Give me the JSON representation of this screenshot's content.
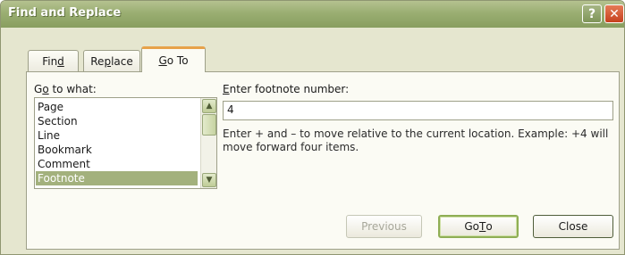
{
  "window": {
    "title": "Find and Replace",
    "help_label": "?",
    "close_label": "✕"
  },
  "tabs": [
    {
      "pre": "Fin",
      "key": "d",
      "post": ""
    },
    {
      "pre": "Re",
      "key": "p",
      "post": "lace"
    },
    {
      "pre": "",
      "key": "G",
      "post": "o To"
    }
  ],
  "goto": {
    "what_label": {
      "pre": "G",
      "key": "o",
      "post": " to what:"
    },
    "items": [
      "Page",
      "Section",
      "Line",
      "Bookmark",
      "Comment",
      "Footnote"
    ],
    "selected": "Footnote",
    "enter_label": {
      "pre": "",
      "key": "E",
      "post": "nter footnote number:"
    },
    "input_value": "4",
    "hint": "Enter + and – to move relative to the current location. Example: +4 will move forward four items."
  },
  "buttons": {
    "previous": "Previous",
    "goto": {
      "pre": "Go ",
      "key": "T",
      "post": "o"
    },
    "close": "Close"
  },
  "colors": {
    "accent": "#e7a24a",
    "selection": "#a3b17d",
    "titlebar": "#9aae72"
  }
}
